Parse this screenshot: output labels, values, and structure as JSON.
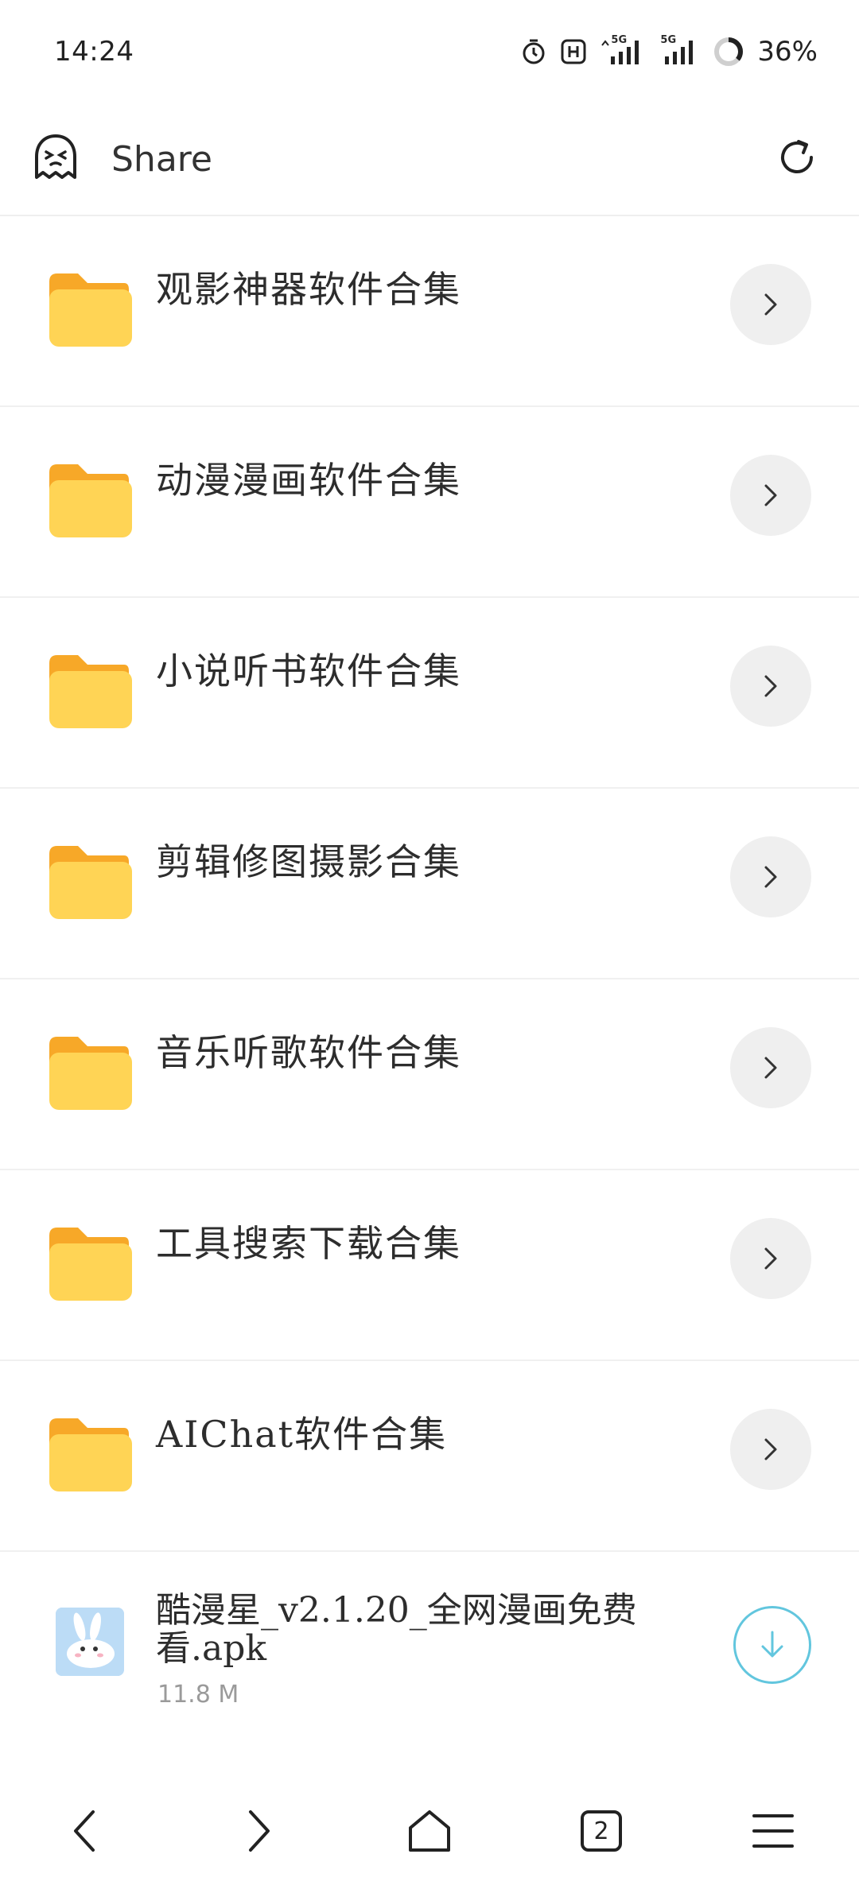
{
  "status_bar": {
    "time": "14:24",
    "battery_percent": "36%",
    "battery_level": 0.36,
    "network_1": "5G",
    "network_2": "5G",
    "icons": [
      "alarm-icon",
      "hd-icon",
      "signal-icon",
      "signal-icon",
      "battery-icon"
    ]
  },
  "header": {
    "title": "Share",
    "left_icon": "ghost-logo-icon",
    "right_icon": "refresh-icon"
  },
  "folders": [
    {
      "name": "观影神器软件合集"
    },
    {
      "name": "动漫漫画软件合集"
    },
    {
      "name": "小说听书软件合集"
    },
    {
      "name": "剪辑修图摄影合集"
    },
    {
      "name": "音乐听歌软件合集"
    },
    {
      "name": "工具搜索下载合集"
    },
    {
      "name": "AIChat软件合集"
    }
  ],
  "file": {
    "name": "酷漫星_v2.1.20_全网漫画免费看.apk",
    "size": "11.8 M"
  },
  "bottom_nav": {
    "tabs_count": "2",
    "items": [
      "back-icon",
      "forward-icon",
      "home-icon",
      "tabs-icon",
      "menu-icon"
    ]
  },
  "colors": {
    "folder_front": "#FFD455",
    "folder_back": "#F7A828",
    "download_accent": "#62C6DE",
    "button_bg": "#EFEFEF"
  }
}
